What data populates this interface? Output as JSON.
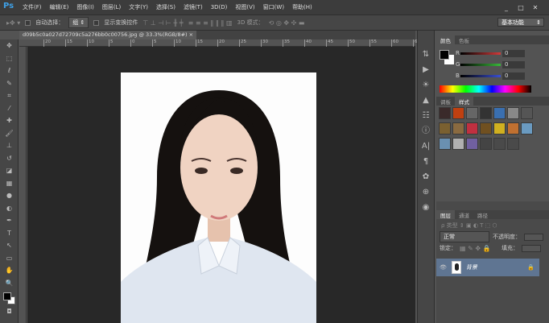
{
  "app": {
    "logo": "Ps"
  },
  "menu": [
    "文件(F)",
    "编辑(E)",
    "图像(I)",
    "图层(L)",
    "文字(Y)",
    "选择(S)",
    "滤镜(T)",
    "3D(D)",
    "视图(V)",
    "窗口(W)",
    "帮助(H)"
  ],
  "window_controls": [
    "_",
    "□",
    "✕"
  ],
  "options": {
    "auto_select_label": "自动选择：",
    "auto_select_value": "组",
    "show_transform_label": "显示变换控件",
    "mode_3d_label": "3D 模式：",
    "workspace": "基本功能"
  },
  "document": {
    "tab_title": "d09b5c0a027d72709c5a276bb0c00756.jpg @ 33.3%(RGB/8#)",
    "close": "×"
  },
  "ruler_ticks": [
    "20",
    "15",
    "10",
    "5",
    "0",
    "5",
    "10",
    "15",
    "20",
    "25",
    "30",
    "35",
    "40",
    "45",
    "50",
    "55",
    "60",
    "65"
  ],
  "color_panel": {
    "tabs": [
      "颜色",
      "色板"
    ],
    "channels": [
      {
        "label": "R",
        "value": "0",
        "color": "#d23a3a"
      },
      {
        "label": "G",
        "value": "0",
        "color": "#39b83a"
      },
      {
        "label": "B",
        "value": "0",
        "color": "#3a4fd2"
      }
    ]
  },
  "styles_panel": {
    "tabs": [
      "调板",
      "样式"
    ]
  },
  "layers_panel": {
    "tabs": [
      "图层",
      "通道",
      "路径"
    ],
    "blend_mode": "正常",
    "opacity_label": "不透明度：",
    "lock_label": "锁定：",
    "fill_label": "填充：",
    "layers": [
      {
        "name": "背景"
      }
    ]
  }
}
